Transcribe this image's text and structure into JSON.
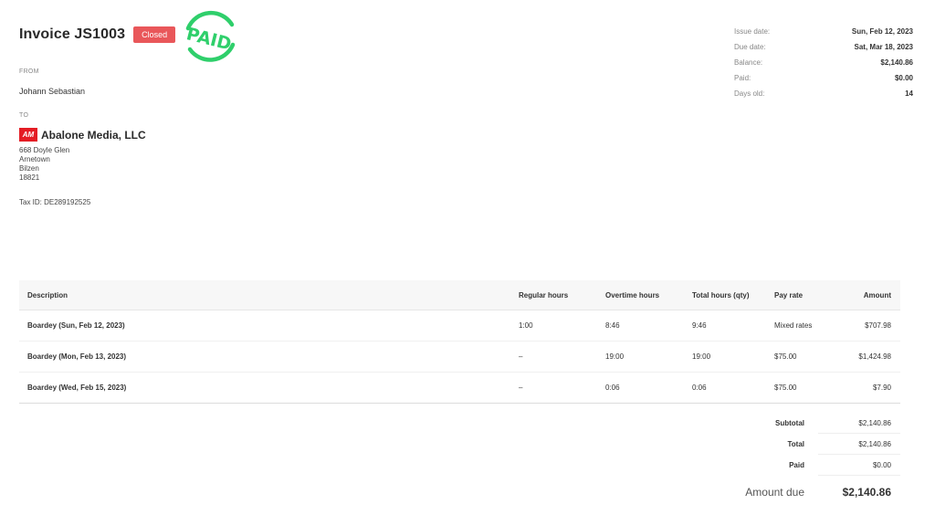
{
  "invoice": {
    "title": "Invoice JS1003",
    "status": "Closed",
    "stamp_text": "PAID",
    "status_color": "#e9575a",
    "stamp_color": "#2fcf6b"
  },
  "from": {
    "label": "FROM",
    "name": "Johann Sebastian"
  },
  "to": {
    "label": "TO",
    "logo_text": "AM",
    "logo_color": "#e41c24",
    "company": "Abalone Media, LLC",
    "address": [
      "668 Doyle Glen",
      "Arnetown",
      "Bilzen",
      "18821"
    ],
    "tax_id": "Tax ID: DE289192525"
  },
  "meta": [
    {
      "key": "Issue date:",
      "value": "Sun, Feb 12, 2023"
    },
    {
      "key": "Due date:",
      "value": "Sat, Mar 18, 2023"
    },
    {
      "key": "Balance:",
      "value": "$2,140.86"
    },
    {
      "key": "Paid:",
      "value": "$0.00"
    },
    {
      "key": "Days old:",
      "value": "14"
    }
  ],
  "table": {
    "headers": {
      "description": "Description",
      "regular": "Regular hours",
      "overtime": "Overtime hours",
      "total": "Total hours (qty)",
      "rate": "Pay rate",
      "amount": "Amount"
    },
    "rows": [
      {
        "description": "Boardey (Sun, Feb 12, 2023)",
        "regular": "1:00",
        "overtime": "8:46",
        "total": "9:46",
        "rate": "Mixed rates",
        "amount": "$707.98"
      },
      {
        "description": "Boardey (Mon, Feb 13, 2023)",
        "regular": "–",
        "overtime": "19:00",
        "total": "19:00",
        "rate": "$75.00",
        "amount": "$1,424.98"
      },
      {
        "description": "Boardey (Wed, Feb 15, 2023)",
        "regular": "–",
        "overtime": "0:06",
        "total": "0:06",
        "rate": "$75.00",
        "amount": "$7.90"
      }
    ]
  },
  "totals": {
    "subtotal_label": "Subtotal",
    "subtotal": "$2,140.86",
    "total_label": "Total",
    "total": "$2,140.86",
    "paid_label": "Paid",
    "paid": "$0.00",
    "due_label": "Amount due",
    "due": "$2,140.86"
  }
}
